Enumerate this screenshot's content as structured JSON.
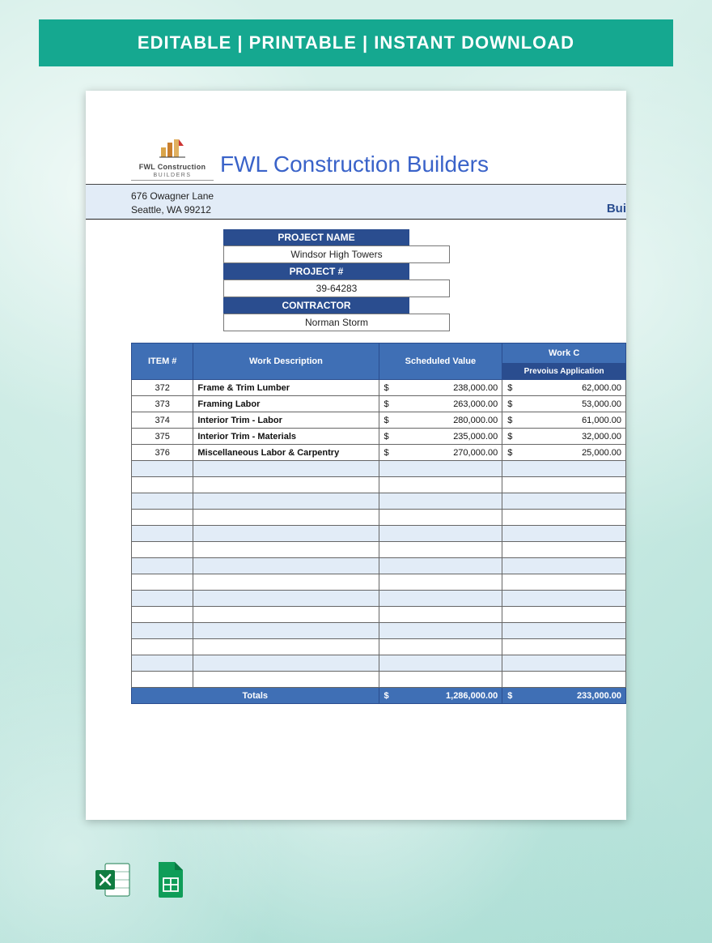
{
  "banner": "EDITABLE  |  PRINTABLE  |  INSTANT DOWNLOAD",
  "logo": {
    "line1": "FWL Construction",
    "line2": "BUILDERS"
  },
  "company_title": "FWL Construction Builders",
  "address": {
    "line1": "676 Owagner Lane",
    "line2": "Seattle, WA 99212"
  },
  "right_cut_text": "Bui",
  "info": {
    "project_name_label": "PROJECT NAME",
    "project_name_value": "Windsor High Towers",
    "project_num_label": "PROJECT #",
    "project_num_value": "39-64283",
    "contractor_label": "CONTRACTOR",
    "contractor_value": "Norman Storm"
  },
  "headers": {
    "item": "ITEM #",
    "desc": "Work Description",
    "scheduled": "Scheduled Value",
    "work_group": "Work C",
    "prev_app": "Prevoius Application"
  },
  "rows": [
    {
      "item": "372",
      "desc": "Frame & Trim Lumber",
      "scheduled": "238,000.00",
      "prev": "62,000.00"
    },
    {
      "item": "373",
      "desc": "Framing Labor",
      "scheduled": "263,000.00",
      "prev": "53,000.00"
    },
    {
      "item": "374",
      "desc": "Interior Trim - Labor",
      "scheduled": "280,000.00",
      "prev": "61,000.00"
    },
    {
      "item": "375",
      "desc": "Interior Trim - Materials",
      "scheduled": "235,000.00",
      "prev": "32,000.00"
    },
    {
      "item": "376",
      "desc": "Miscellaneous Labor & Carpentry",
      "scheduled": "270,000.00",
      "prev": "25,000.00"
    }
  ],
  "empty_row_count": 14,
  "totals": {
    "label": "Totals",
    "scheduled": "1,286,000.00",
    "prev": "233,000.00"
  },
  "currency_symbol": "$",
  "icons": {
    "excel": "excel-icon",
    "sheets": "google-sheets-icon"
  }
}
